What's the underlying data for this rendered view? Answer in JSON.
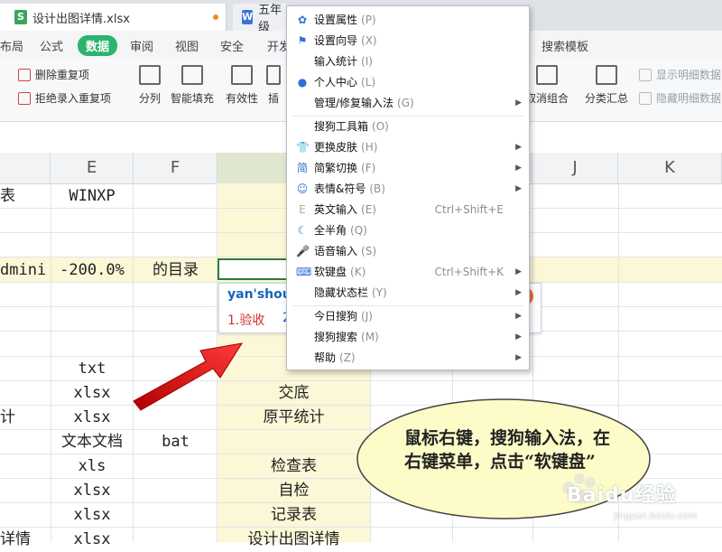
{
  "tabs": [
    {
      "label": "设计出图详情.xlsx",
      "modified": true
    },
    {
      "label": "五年级"
    }
  ],
  "ribbon": {
    "tabs": [
      "布局",
      "公式",
      "数据",
      "审阅",
      "视图",
      "安全",
      "开发"
    ],
    "active_tab": "数据",
    "right_tab": "搜索模板",
    "small_buttons": [
      "删除重复项",
      "拒绝录入重复项"
    ],
    "big_buttons": [
      "分列",
      "智能填充",
      "有效性",
      "插"
    ],
    "right_buttons": [
      "取消组合",
      "分类汇总"
    ],
    "right_small": [
      "显示明细数据",
      "隐藏明细数据"
    ]
  },
  "sheet": {
    "columns": [
      "E",
      "F",
      "",
      "J",
      "K"
    ],
    "cells": {
      "r1_d": "表",
      "r1_e": "WINXP",
      "r4_d": "dmini",
      "r4_e": "-200.0%",
      "r4_f": "的目录",
      "r8_e": "txt",
      "r9_e": "xlsx",
      "r9_g": "交底",
      "r10_d": "计",
      "r10_e": "xlsx",
      "r10_g": "原平统计",
      "r11_e": "文本文档",
      "r11_f": "bat",
      "r12_e": "xls",
      "r12_g": "检查表",
      "r13_e": "xlsx",
      "r13_g": "自检",
      "r14_e": "xlsx",
      "r14_g": "记录表",
      "r15_d": "详情",
      "r15_e": "xlsx",
      "r15_g": "设计出图详情"
    }
  },
  "ime": {
    "pinyin": "yan'shou",
    "candidate1": "1.验收",
    "candidate2": "2"
  },
  "context_menu": {
    "items": [
      {
        "label": "设置属性",
        "hotkey": "(P)",
        "icon": "gear-icon"
      },
      {
        "label": "设置向导",
        "hotkey": "(X)",
        "icon": "flag-icon"
      },
      {
        "label": "输入统计",
        "hotkey": "(I)"
      },
      {
        "label": "个人中心",
        "hotkey": "(L)",
        "icon": "user-icon"
      },
      {
        "label": "管理/修复输入法",
        "hotkey": "(G)",
        "submenu": true
      },
      {
        "label": "搜狗工具箱",
        "hotkey": "(O)"
      },
      {
        "label": "更换皮肤",
        "hotkey": "(H)",
        "icon": "shirt-icon",
        "submenu": true
      },
      {
        "label": "简繁切换",
        "hotkey": "(F)",
        "icon": "jian-icon",
        "submenu": true
      },
      {
        "label": "表情&符号",
        "hotkey": "(B)",
        "icon": "smiley-icon",
        "submenu": true
      },
      {
        "label": "英文输入",
        "hotkey": "(E)",
        "icon": "e-icon",
        "shortcut": "Ctrl+Shift+E"
      },
      {
        "label": "全半角",
        "hotkey": "(Q)",
        "icon": "moon-icon"
      },
      {
        "label": "语音输入",
        "hotkey": "(S)",
        "icon": "mic-icon"
      },
      {
        "label": "软键盘",
        "hotkey": "(K)",
        "icon": "keyboard-icon",
        "shortcut": "Ctrl+Shift+K",
        "submenu": true
      },
      {
        "label": "隐藏状态栏",
        "hotkey": "(Y)",
        "submenu": true
      },
      {
        "label": "今日搜狗",
        "hotkey": "(J)",
        "submenu": true
      },
      {
        "label": "搜狗搜索",
        "hotkey": "(M)",
        "submenu": true
      },
      {
        "label": "帮助",
        "hotkey": "(Z)",
        "submenu": true
      }
    ]
  },
  "annotation": {
    "text": "鼠标右键，搜狗输入法，在右键菜单，点击“软键盘”"
  },
  "watermark": {
    "brand": "Baidu经验",
    "url": "jingyan.baidu.com"
  },
  "colors": {
    "accent_green": "#2db46c",
    "highlight_yellow": "#fbf7d7",
    "arrow_red": "#e02020",
    "bubble_fill": "#fdfbc8"
  }
}
